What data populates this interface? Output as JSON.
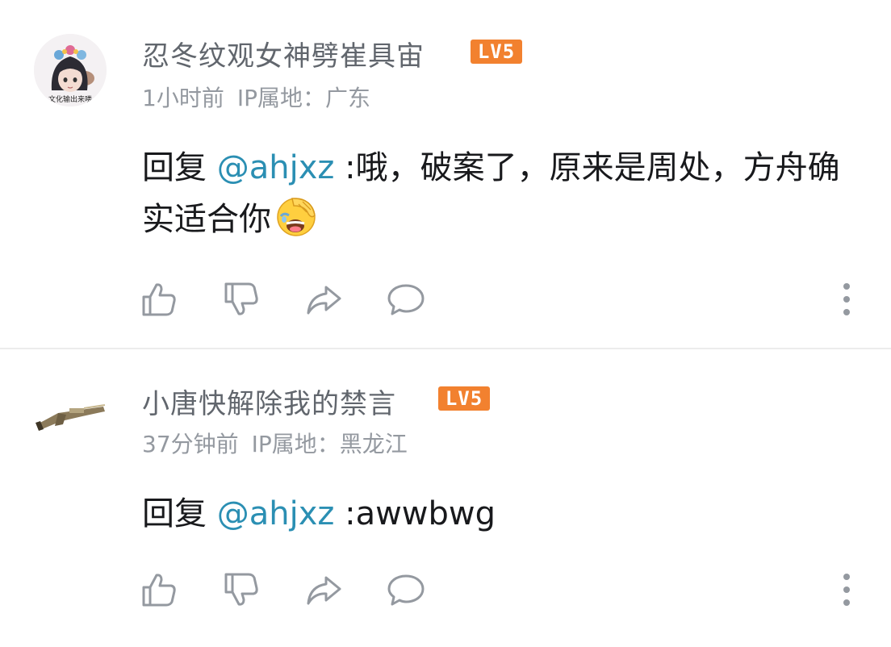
{
  "comments": [
    {
      "username": "忍冬纹观女神劈崔具宙",
      "level": "LV5",
      "avatar_caption": "文化输出来喽",
      "time": "1小时前",
      "ip_label": "IP属地：",
      "ip_region": "广东",
      "reply_prefix": "回复 ",
      "mention": "@ahjxz",
      "text": " :哦，破案了，原来是周处，方舟确实适合你",
      "emoji": "facepalm-laugh-emoji"
    },
    {
      "username": "小唐快解除我的禁言",
      "level": "LV5",
      "time": "37分钟前",
      "ip_label": "IP属地：",
      "ip_region": "黑龙江",
      "reply_prefix": "回复 ",
      "mention": "@ahjxz",
      "text": " :awwbwg"
    }
  ],
  "icons": {
    "like": "thumbs-up-icon",
    "dislike": "thumbs-down-icon",
    "share": "share-icon",
    "reply": "comment-icon",
    "more": "more-vertical-icon"
  },
  "colors": {
    "mention": "#2b8fb3",
    "level_badge": "#f2812f",
    "username": "#61666d",
    "meta": "#9499a0",
    "icon": "#9499a0"
  }
}
